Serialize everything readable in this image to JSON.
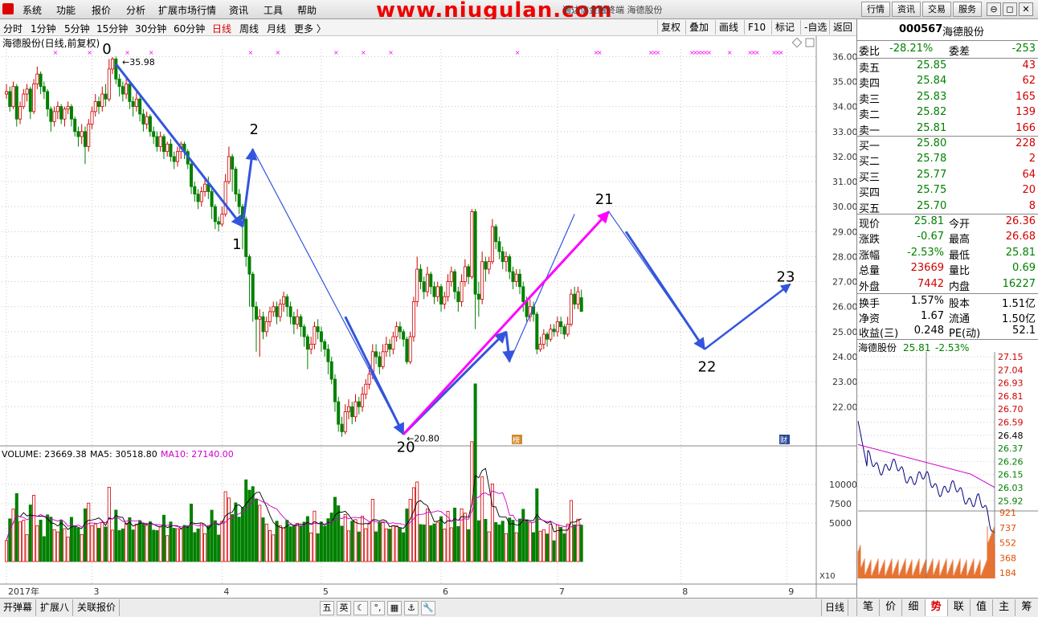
{
  "menu": [
    "系统",
    "功能",
    "报价",
    "分析",
    "扩展市场行情",
    "资讯",
    "工具",
    "帮助"
  ],
  "watermark": "www.niugulan.com",
  "window_title": "通达信金融终端    海德股份",
  "top_buttons": [
    "行情",
    "资讯",
    "交易",
    "服务"
  ],
  "periods": [
    "分时",
    "1分钟",
    "5分钟",
    "15分钟",
    "30分钟",
    "60分钟",
    "日线",
    "周线",
    "月线",
    "更多 〉"
  ],
  "active_period": "日线",
  "chart_tools": [
    "复权",
    "叠加",
    "画线",
    "F10",
    "标记",
    "-自选",
    "返回"
  ],
  "stock": {
    "code": "000567",
    "name": "海德股份",
    "chart_label": "海德股份(日线,前复权)"
  },
  "order_ratio": {
    "label1": "委比",
    "value1": "-28.21%",
    "label2": "委差",
    "value2": "-253"
  },
  "asks": [
    {
      "label": "卖五",
      "price": "25.85",
      "vol": "43"
    },
    {
      "label": "卖四",
      "price": "25.84",
      "vol": "62"
    },
    {
      "label": "卖三",
      "price": "25.83",
      "vol": "165"
    },
    {
      "label": "卖二",
      "price": "25.82",
      "vol": "139"
    },
    {
      "label": "卖一",
      "price": "25.81",
      "vol": "166"
    }
  ],
  "bids": [
    {
      "label": "买一",
      "price": "25.80",
      "vol": "228"
    },
    {
      "label": "买二",
      "price": "25.78",
      "vol": "2"
    },
    {
      "label": "买三",
      "price": "25.77",
      "vol": "64"
    },
    {
      "label": "买四",
      "price": "25.75",
      "vol": "20"
    },
    {
      "label": "买五",
      "price": "25.70",
      "vol": "8"
    }
  ],
  "quote": [
    {
      "l1": "现价",
      "v1": "25.81",
      "c1": "green",
      "l2": "今开",
      "v2": "26.36",
      "c2": "red"
    },
    {
      "l1": "涨跌",
      "v1": "-0.67",
      "c1": "green",
      "l2": "最高",
      "v2": "26.68",
      "c2": "red"
    },
    {
      "l1": "涨幅",
      "v1": "-2.53%",
      "c1": "green",
      "l2": "最低",
      "v2": "25.81",
      "c2": "green"
    },
    {
      "l1": "总量",
      "v1": "23669",
      "c1": "red",
      "l2": "量比",
      "v2": "0.69",
      "c2": "green"
    },
    {
      "l1": "外盘",
      "v1": "7442",
      "c1": "red",
      "l2": "内盘",
      "v2": "16227",
      "c2": "green"
    }
  ],
  "fundamentals": [
    {
      "l1": "换手",
      "v1": "1.57%",
      "l2": "股本",
      "v2": "1.51亿"
    },
    {
      "l1": "净资",
      "v1": "1.67",
      "l2": "流通",
      "v2": "1.50亿"
    },
    {
      "l1": "收益(三)",
      "v1": "0.248",
      "l2": "PE(动)",
      "v2": "52.1"
    }
  ],
  "mini": {
    "title": "海德股份",
    "price": "25.81",
    "change": "-2.53%",
    "price_ticks": [
      "27.15",
      "27.04",
      "26.93",
      "26.81",
      "26.70",
      "26.59",
      "26.48",
      "26.37",
      "26.26",
      "26.15",
      "26.03",
      "25.92"
    ],
    "vol_ticks": [
      "921",
      "737",
      "552",
      "368",
      "184"
    ]
  },
  "bottom_tabs": [
    "开弹幕",
    "扩展八",
    "关联报价"
  ],
  "right_tabs": [
    "笔",
    "价",
    "细",
    "势",
    "联",
    "值",
    "主",
    "筹"
  ],
  "active_right_tab": "势",
  "ime": [
    "五",
    "英",
    "☾",
    "°,",
    "▦",
    "⚓",
    "🔧"
  ],
  "chart_data": {
    "type": "candlestick",
    "y_ticks": [
      "36.00",
      "35.00",
      "34.00",
      "33.00",
      "32.00",
      "31.00",
      "30.00",
      "29.00",
      "28.00",
      "27.00",
      "26.00",
      "25.00",
      "24.00",
      "23.00",
      "22.00"
    ],
    "ylim": [
      20.5,
      36.3
    ],
    "x_labels": [
      "2017年",
      "3",
      "4",
      "5",
      "6",
      "7",
      "8",
      "9"
    ],
    "x_label_index": [
      0,
      25,
      63,
      92,
      127,
      161,
      197,
      228
    ],
    "high_label": "35.98",
    "low_label": "20.80",
    "candles": [
      [
        34.5,
        34.6,
        34.9,
        34.3
      ],
      [
        34.6,
        34.0,
        34.8,
        33.8
      ],
      [
        34.0,
        34.8,
        35.0,
        33.9
      ],
      [
        34.8,
        33.5,
        34.9,
        33.2
      ],
      [
        33.5,
        34.0,
        34.2,
        33.3
      ],
      [
        34.0,
        34.5,
        34.7,
        33.9
      ],
      [
        34.5,
        34.7,
        34.9,
        34.2
      ],
      [
        34.7,
        33.8,
        34.8,
        33.5
      ],
      [
        33.8,
        34.9,
        35.1,
        33.7
      ],
      [
        34.9,
        35.3,
        35.6,
        34.7
      ],
      [
        35.3,
        34.8,
        35.4,
        34.5
      ],
      [
        34.8,
        34.6,
        35.0,
        34.3
      ],
      [
        34.6,
        33.9,
        34.7,
        33.6
      ],
      [
        33.9,
        33.4,
        34.0,
        33.0
      ],
      [
        33.4,
        33.8,
        34.0,
        33.2
      ],
      [
        33.8,
        34.0,
        34.2,
        33.5
      ],
      [
        34.0,
        33.5,
        34.1,
        33.3
      ],
      [
        33.5,
        33.9,
        34.0,
        33.2
      ],
      [
        33.9,
        34.0,
        34.2,
        33.7
      ],
      [
        34.0,
        33.5,
        34.1,
        33.2
      ],
      [
        33.5,
        33.0,
        33.6,
        32.8
      ],
      [
        33.0,
        32.8,
        33.2,
        32.4
      ],
      [
        32.8,
        33.0,
        33.3,
        32.5
      ],
      [
        33.0,
        32.4,
        33.2,
        31.7
      ],
      [
        32.4,
        33.3,
        33.5,
        32.2
      ],
      [
        33.3,
        33.8,
        34.0,
        33.1
      ],
      [
        33.8,
        34.2,
        34.5,
        33.6
      ],
      [
        34.2,
        34.0,
        34.4,
        33.7
      ],
      [
        34.0,
        34.5,
        34.8,
        33.8
      ],
      [
        34.5,
        34.3,
        34.9,
        34.0
      ],
      [
        34.3,
        35.5,
        35.9,
        34.2
      ],
      [
        35.5,
        35.9,
        35.98,
        35.3
      ],
      [
        35.9,
        35.1,
        36.0,
        34.9
      ],
      [
        35.1,
        34.8,
        35.3,
        34.4
      ],
      [
        34.8,
        34.5,
        35.0,
        34.2
      ],
      [
        34.5,
        34.9,
        35.1,
        34.3
      ],
      [
        34.9,
        34.2,
        35.0,
        33.9
      ],
      [
        34.2,
        34.0,
        34.4,
        33.6
      ],
      [
        34.0,
        34.3,
        34.6,
        33.8
      ],
      [
        34.3,
        33.7,
        34.4,
        33.4
      ],
      [
        33.7,
        33.3,
        33.9,
        33.0
      ],
      [
        33.3,
        33.6,
        33.8,
        33.1
      ],
      [
        33.6,
        33.0,
        33.7,
        32.8
      ],
      [
        33.0,
        32.8,
        33.2,
        32.5
      ],
      [
        32.8,
        32.4,
        33.0,
        32.2
      ],
      [
        32.4,
        32.8,
        33.0,
        32.2
      ],
      [
        32.8,
        32.2,
        32.9,
        31.9
      ],
      [
        32.2,
        32.5,
        32.6,
        32.0
      ],
      [
        32.5,
        32.0,
        32.7,
        31.8
      ],
      [
        32.0,
        31.8,
        32.2,
        31.5
      ],
      [
        31.8,
        32.2,
        32.4,
        31.6
      ],
      [
        32.2,
        32.5,
        32.6,
        31.9
      ],
      [
        32.5,
        32.2,
        32.6,
        31.9
      ],
      [
        32.2,
        31.7,
        32.3,
        31.5
      ],
      [
        31.7,
        30.8,
        31.8,
        30.5
      ],
      [
        30.8,
        30.5,
        31.0,
        30.2
      ],
      [
        30.5,
        30.2,
        30.7,
        29.9
      ],
      [
        30.2,
        30.6,
        30.8,
        30.0
      ],
      [
        30.6,
        30.9,
        31.1,
        30.4
      ],
      [
        30.9,
        30.6,
        31.2,
        30.3
      ],
      [
        30.6,
        30.0,
        30.7,
        29.5
      ],
      [
        30.0,
        29.4,
        30.1,
        29.1
      ],
      [
        29.4,
        29.3,
        29.6,
        29.0
      ],
      [
        29.3,
        29.7,
        30.0,
        29.2
      ],
      [
        29.7,
        31.0,
        31.3,
        29.6
      ],
      [
        31.0,
        32.0,
        32.4,
        30.9
      ],
      [
        32.0,
        31.5,
        32.1,
        30.6
      ],
      [
        31.5,
        30.5,
        31.6,
        30.2
      ],
      [
        30.5,
        30.0,
        30.7,
        29.7
      ],
      [
        30.0,
        29.5,
        30.1,
        28.3
      ],
      [
        29.5,
        28.0,
        29.6,
        27.6
      ],
      [
        28.0,
        27.3,
        28.1,
        26.0
      ],
      [
        27.3,
        26.0,
        27.4,
        25.4
      ],
      [
        26.0,
        25.5,
        26.2,
        24.2
      ],
      [
        25.5,
        25.6,
        25.9,
        24.0
      ],
      [
        25.6,
        25.0,
        25.8,
        24.7
      ],
      [
        25.0,
        25.4,
        25.6,
        24.8
      ],
      [
        25.4,
        25.8,
        26.0,
        25.2
      ],
      [
        25.8,
        26.0,
        26.2,
        25.6
      ],
      [
        26.0,
        25.6,
        26.2,
        25.3
      ],
      [
        25.6,
        26.1,
        26.3,
        25.4
      ],
      [
        26.1,
        26.4,
        26.6,
        25.8
      ],
      [
        26.4,
        26.0,
        26.5,
        25.6
      ],
      [
        26.0,
        25.6,
        26.2,
        25.3
      ],
      [
        25.6,
        25.3,
        25.8,
        24.9
      ],
      [
        25.3,
        25.6,
        25.9,
        25.1
      ],
      [
        25.6,
        25.2,
        25.7,
        24.8
      ],
      [
        25.2,
        24.8,
        25.3,
        24.4
      ],
      [
        24.8,
        24.3,
        24.9,
        23.5
      ],
      [
        24.3,
        24.5,
        24.8,
        24.1
      ],
      [
        24.5,
        25.2,
        25.4,
        24.3
      ],
      [
        25.2,
        25.0,
        25.5,
        24.7
      ],
      [
        25.0,
        24.6,
        25.2,
        24.2
      ],
      [
        24.6,
        24.3,
        24.7,
        24.0
      ],
      [
        24.3,
        23.8,
        24.5,
        23.3
      ],
      [
        23.8,
        23.1,
        24.0,
        22.9
      ],
      [
        23.1,
        22.2,
        23.3,
        21.8
      ],
      [
        22.2,
        21.3,
        22.4,
        21.0
      ],
      [
        21.3,
        21.0,
        21.6,
        20.8
      ],
      [
        21.0,
        21.8,
        22.1,
        20.9
      ],
      [
        21.8,
        22.0,
        22.3,
        21.5
      ],
      [
        22.0,
        21.6,
        22.2,
        21.3
      ],
      [
        21.6,
        22.2,
        22.5,
        21.4
      ],
      [
        22.2,
        22.0,
        22.4,
        21.7
      ],
      [
        22.0,
        22.5,
        22.8,
        21.8
      ],
      [
        22.5,
        22.9,
        23.1,
        22.3
      ],
      [
        22.9,
        23.3,
        23.6,
        22.7
      ],
      [
        23.3,
        24.2,
        24.5,
        23.1
      ],
      [
        24.2,
        24.0,
        24.5,
        23.7
      ],
      [
        24.0,
        23.6,
        24.2,
        23.3
      ],
      [
        23.6,
        24.2,
        24.5,
        23.5
      ],
      [
        24.2,
        24.5,
        24.8,
        24.0
      ],
      [
        24.5,
        24.3,
        24.7,
        24.0
      ],
      [
        24.3,
        24.8,
        25.0,
        24.1
      ],
      [
        24.8,
        25.2,
        25.4,
        24.6
      ],
      [
        25.2,
        25.0,
        25.4,
        24.7
      ],
      [
        25.0,
        24.7,
        25.1,
        24.4
      ],
      [
        24.7,
        23.8,
        24.8,
        23.7
      ],
      [
        23.8,
        24.8,
        25.0,
        23.7
      ],
      [
        24.8,
        26.2,
        26.4,
        24.6
      ],
      [
        26.2,
        27.5,
        28.0,
        26.0
      ],
      [
        27.5,
        27.0,
        27.7,
        26.7
      ],
      [
        27.0,
        26.6,
        27.2,
        26.3
      ],
      [
        26.6,
        27.3,
        27.6,
        26.4
      ],
      [
        27.3,
        26.8,
        27.4,
        26.5
      ],
      [
        26.8,
        26.4,
        27.0,
        26.1
      ],
      [
        26.4,
        26.8,
        27.0,
        26.2
      ],
      [
        26.8,
        26.1,
        26.9,
        25.8
      ],
      [
        26.1,
        26.4,
        26.6,
        25.9
      ],
      [
        26.4,
        27.0,
        27.3,
        26.2
      ],
      [
        27.0,
        27.4,
        27.6,
        26.8
      ],
      [
        27.4,
        26.6,
        27.5,
        26.3
      ],
      [
        26.6,
        26.2,
        26.8,
        25.8
      ],
      [
        26.2,
        27.0,
        27.3,
        26.0
      ],
      [
        27.0,
        27.6,
        27.9,
        26.8
      ],
      [
        27.6,
        27.2,
        27.7,
        26.9
      ],
      [
        27.2,
        29.8,
        29.9,
        27.1
      ],
      [
        29.8,
        26.5,
        29.9,
        25.1
      ],
      [
        26.5,
        26.3,
        27.0,
        25.6
      ],
      [
        26.3,
        27.8,
        28.2,
        26.1
      ],
      [
        27.8,
        27.5,
        28.0,
        27.0
      ],
      [
        27.5,
        27.8,
        28.0,
        27.3
      ],
      [
        27.8,
        29.2,
        29.5,
        27.7
      ],
      [
        29.2,
        28.6,
        29.3,
        28.3
      ],
      [
        28.6,
        28.2,
        28.8,
        27.9
      ],
      [
        28.2,
        27.8,
        28.4,
        27.5
      ],
      [
        27.8,
        28.0,
        28.2,
        27.4
      ],
      [
        28.0,
        27.4,
        28.1,
        27.1
      ],
      [
        27.4,
        27.0,
        27.6,
        26.7
      ],
      [
        27.0,
        27.3,
        27.5,
        26.8
      ],
      [
        27.3,
        26.8,
        27.5,
        26.5
      ],
      [
        26.8,
        26.2,
        27.0,
        25.8
      ],
      [
        26.2,
        25.6,
        26.4,
        25.4
      ],
      [
        25.6,
        26.0,
        26.3,
        25.4
      ],
      [
        26.0,
        25.7,
        26.2,
        25.4
      ],
      [
        25.7,
        24.3,
        25.8,
        24.1
      ],
      [
        24.3,
        24.5,
        24.8,
        24.2
      ],
      [
        24.5,
        24.9,
        25.1,
        24.3
      ],
      [
        24.9,
        24.7,
        25.0,
        24.4
      ],
      [
        24.7,
        25.1,
        25.3,
        24.6
      ],
      [
        25.1,
        25.0,
        25.3,
        24.8
      ],
      [
        25.0,
        25.4,
        25.6,
        24.8
      ],
      [
        25.4,
        25.2,
        25.6,
        24.9
      ],
      [
        25.2,
        24.9,
        25.3,
        24.7
      ],
      [
        24.9,
        25.3,
        25.6,
        24.8
      ],
      [
        25.3,
        26.5,
        26.7,
        25.2
      ],
      [
        26.5,
        26.1,
        26.8,
        25.9
      ],
      [
        26.1,
        26.6,
        26.8,
        25.9
      ],
      [
        26.36,
        25.81,
        26.68,
        25.81
      ]
    ],
    "volume_ma_text": {
      "volume": "VOLUME: 23669.38",
      "ma5": "MA5: 30518.80",
      "ma10": "MA10: 27140.00"
    },
    "volume_ticks": [
      "10000",
      "7500",
      "5000"
    ],
    "volume_unit": "X10",
    "volume_ylim": [
      0,
      12500
    ],
    "waves": [
      {
        "label": "0",
        "i": 30,
        "y": 35.98
      },
      {
        "label": "1",
        "i": 69,
        "y": 29.1
      },
      {
        "label": "2",
        "i": 72,
        "y": 32.4
      },
      {
        "label": "20",
        "i": 116,
        "y": 20.8
      },
      {
        "label": "21",
        "i": 166,
        "y": 29.8
      },
      {
        "label": "22",
        "i": 204,
        "y": 24.2
      },
      {
        "label": "23",
        "i": 229,
        "y": 26.8
      }
    ]
  },
  "colors": {
    "up": "#d00000",
    "down": "#008000",
    "arrow": "#3355dd",
    "pink": "#ff00ff",
    "grid": "#c8c8c8",
    "ma5": "#000000",
    "ma10": "#cc00cc",
    "mini_line": "#000080",
    "mini_avg": "#cc00cc",
    "mini_vol": "#e05000"
  }
}
